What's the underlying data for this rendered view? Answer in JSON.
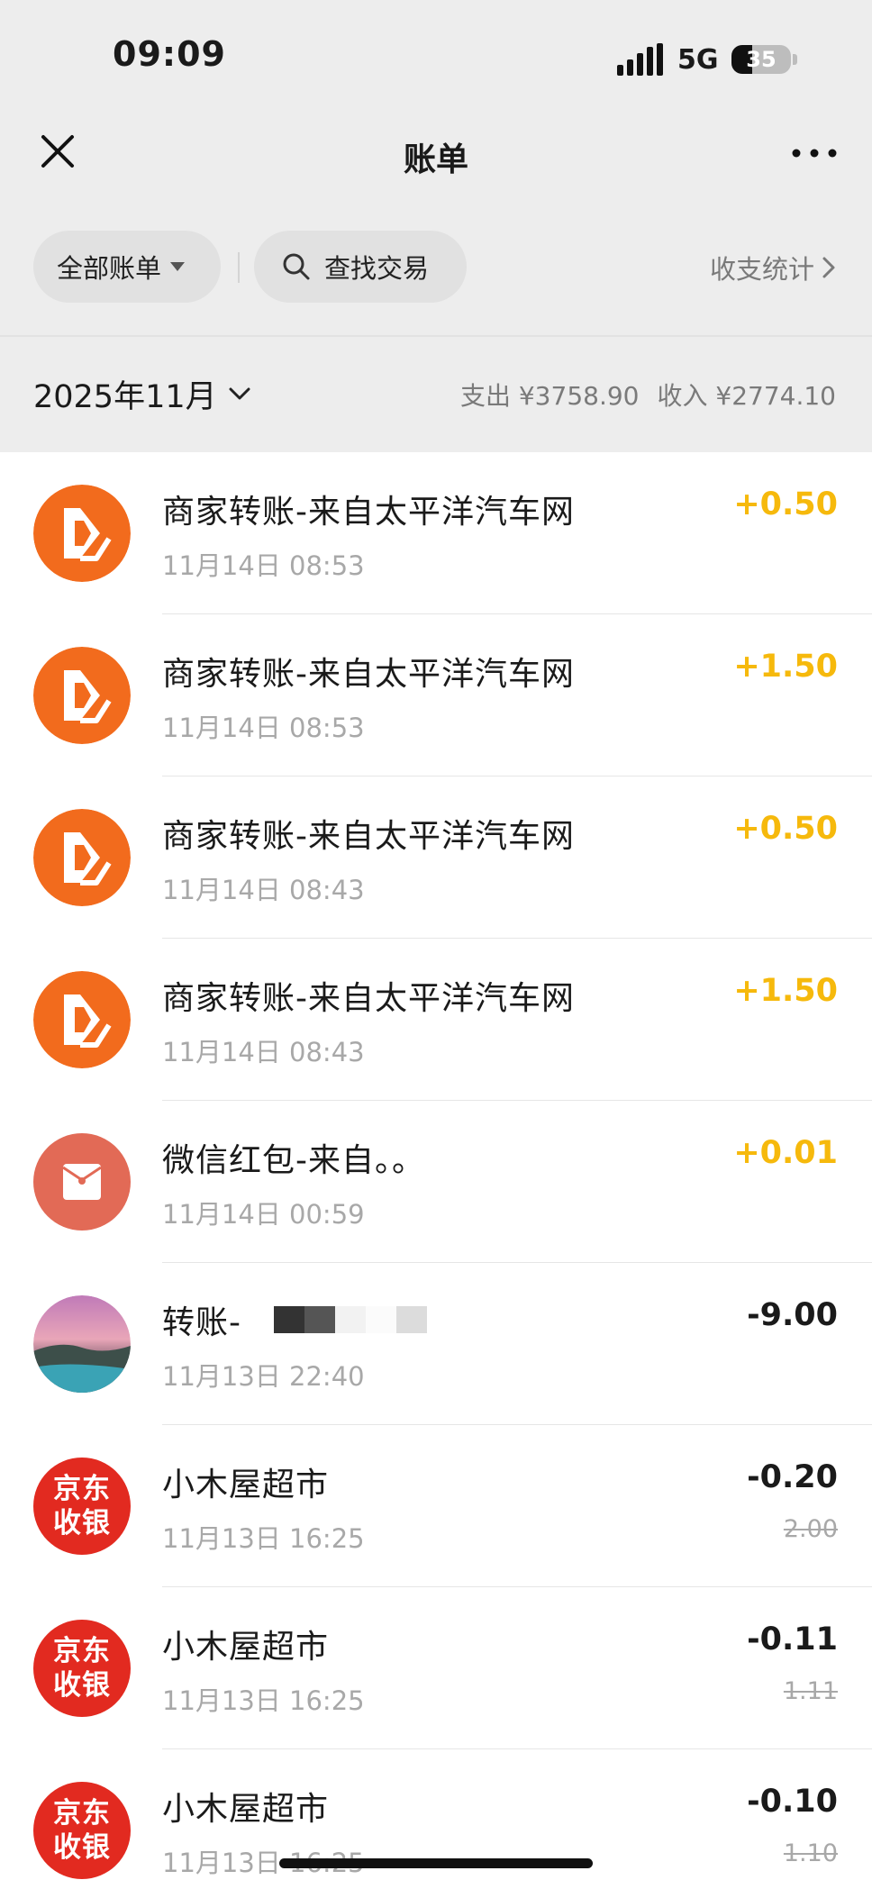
{
  "status_bar": {
    "time": "09:09",
    "network": "5G",
    "battery": "35",
    "battery_level": 0.35
  },
  "nav": {
    "title": "账单"
  },
  "filters": {
    "all_bills": "全部账单",
    "search": "查找交易",
    "stats": "收支统计"
  },
  "month_header": {
    "month": "2025年11月",
    "expense": "支出 ¥3758.90",
    "income": "收入 ¥2774.10"
  },
  "colors": {
    "income": "#f6b90c",
    "pacific_logo": "#f26b1d",
    "jd_red": "#e22a20",
    "red_packet": "#e26a56"
  },
  "transactions": [
    {
      "icon": "pacific-auto-logo-icon",
      "title": "商家转账-来自太平洋汽车网",
      "time": "11月14日 08:53",
      "amount": "+0.50",
      "type": "income"
    },
    {
      "icon": "pacific-auto-logo-icon",
      "title": "商家转账-来自太平洋汽车网",
      "time": "11月14日 08:53",
      "amount": "+1.50",
      "type": "income"
    },
    {
      "icon": "pacific-auto-logo-icon",
      "title": "商家转账-来自太平洋汽车网",
      "time": "11月14日 08:43",
      "amount": "+0.50",
      "type": "income"
    },
    {
      "icon": "pacific-auto-logo-icon",
      "title": "商家转账-来自太平洋汽车网",
      "time": "11月14日 08:43",
      "amount": "+1.50",
      "type": "income"
    },
    {
      "icon": "red-packet-icon",
      "title": "微信红包-来自。。",
      "time": "11月14日 00:59",
      "amount": "+0.01",
      "type": "income"
    },
    {
      "icon": "user-avatar",
      "title": "转账-",
      "time": "11月13日 22:40",
      "amount": "-9.00",
      "type": "expense"
    },
    {
      "icon": "jd-pay-logo-icon",
      "logo_text": [
        "京东",
        "收银"
      ],
      "title": "小木屋超市",
      "time": "11月13日 16:25",
      "amount": "-0.20",
      "original": "2.00",
      "type": "expense"
    },
    {
      "icon": "jd-pay-logo-icon",
      "logo_text": [
        "京东",
        "收银"
      ],
      "title": "小木屋超市",
      "time": "11月13日 16:25",
      "amount": "-0.11",
      "original": "1.11",
      "type": "expense"
    },
    {
      "icon": "jd-pay-logo-icon",
      "logo_text": [
        "京东",
        "收银"
      ],
      "title": "小木屋超市",
      "time": "11月13日 16:25",
      "amount": "-0.10",
      "original": "1.10",
      "type": "expense"
    }
  ]
}
